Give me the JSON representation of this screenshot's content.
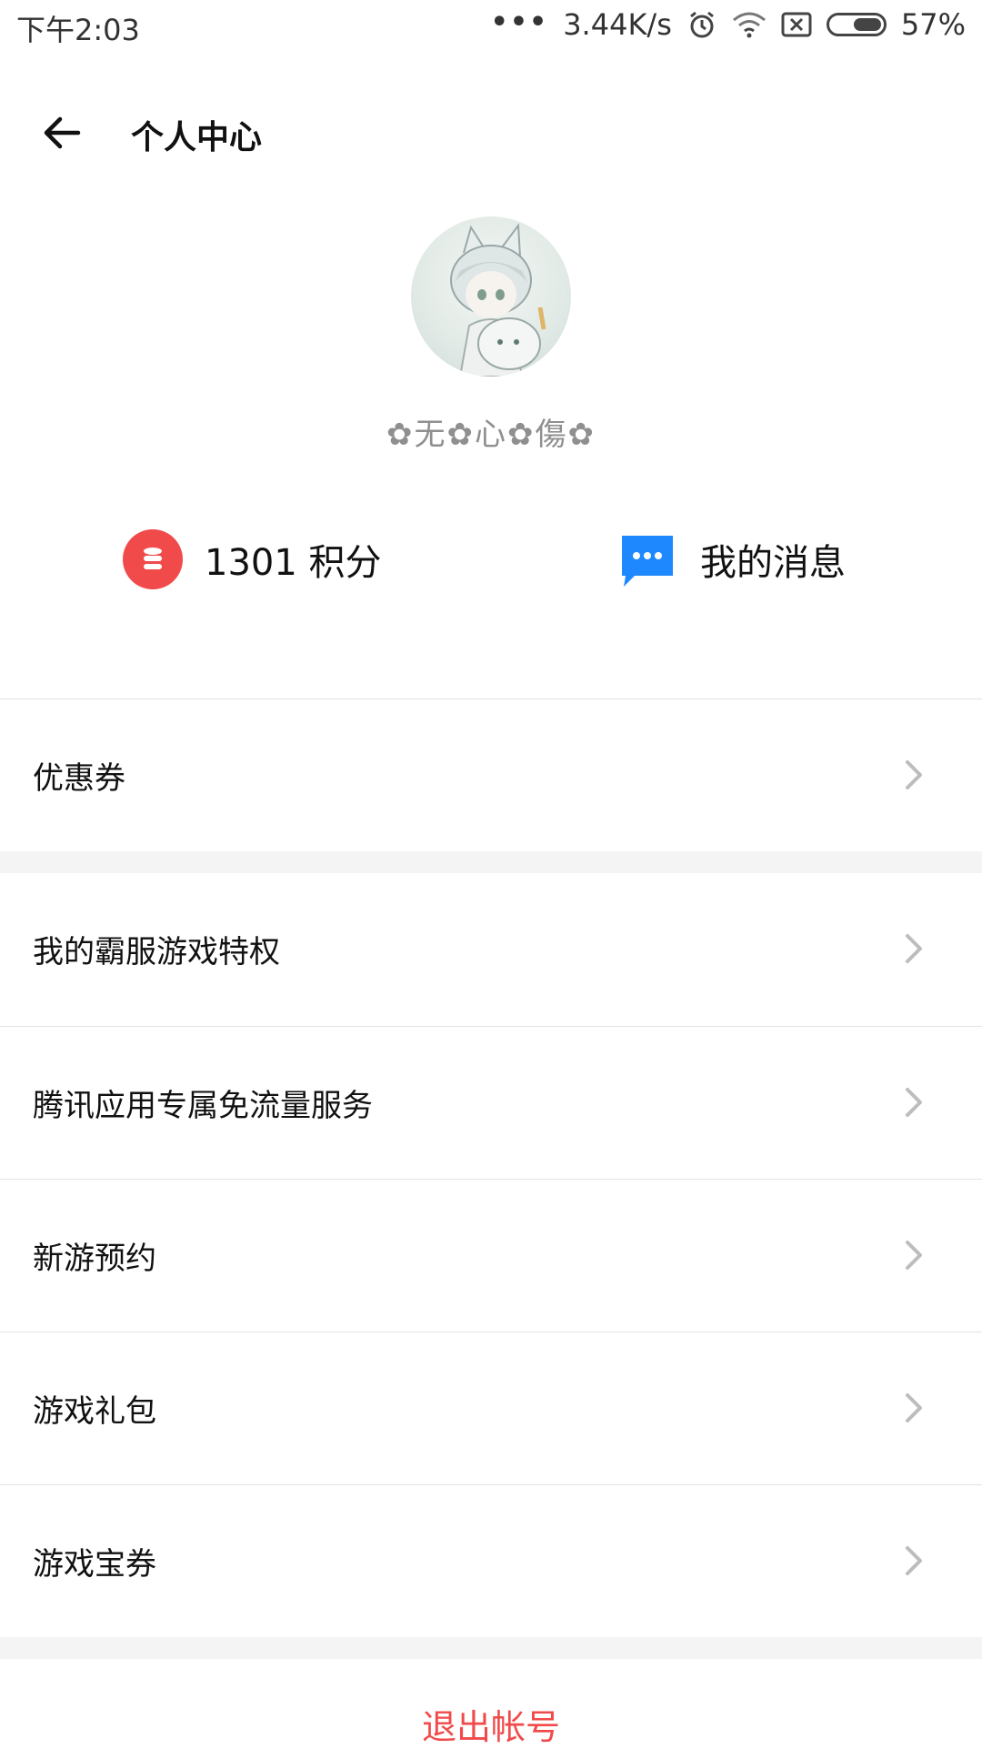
{
  "status_bar": {
    "time": "下午2:03",
    "dots": "•••",
    "speed": "3.44K/s",
    "battery": "57%",
    "icons": [
      "alarm-icon",
      "wifi-icon",
      "no-sim-icon",
      "battery-icon"
    ]
  },
  "header": {
    "title": "个人中心",
    "back_icon": "arrow-left-icon"
  },
  "profile": {
    "nickname": "✿无✿心✿傷✿"
  },
  "quick_actions": {
    "points_value": "1301 积分",
    "messages_label": "我的消息",
    "points_color": "#F14A4A",
    "message_color": "#1E88FF"
  },
  "menu": {
    "items": [
      {
        "label": "优惠券"
      },
      {
        "label": "我的霸服游戏特权"
      },
      {
        "label": "腾讯应用专属免流量服务"
      },
      {
        "label": "新游预约"
      },
      {
        "label": "游戏礼包"
      },
      {
        "label": "游戏宝券"
      }
    ]
  },
  "logout": {
    "label": "退出帐号"
  }
}
